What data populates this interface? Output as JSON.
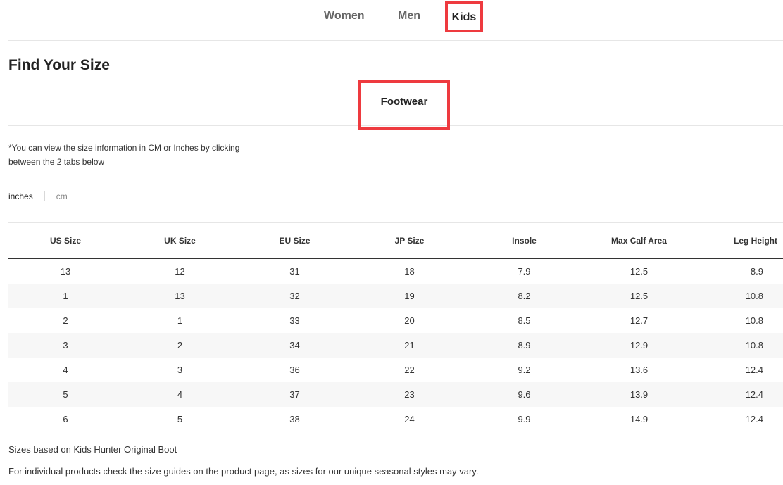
{
  "gender_tabs": [
    {
      "label": "Women"
    },
    {
      "label": "Men"
    },
    {
      "label": "Kids"
    }
  ],
  "page_title": "Find Your Size",
  "category_tab": "Footwear",
  "note": "*You can view the size information in CM or Inches by clicking between the 2 tabs below",
  "units": {
    "inches": "inches",
    "cm": "cm"
  },
  "table": {
    "headers": [
      "US Size",
      "UK Size",
      "EU Size",
      "JP Size",
      "Insole",
      "Max Calf Area",
      "Leg Height"
    ],
    "rows": [
      [
        "13",
        "12",
        "31",
        "18",
        "7.9",
        "12.5",
        "8.9"
      ],
      [
        "1",
        "13",
        "32",
        "19",
        "8.2",
        "12.5",
        "10.8"
      ],
      [
        "2",
        "1",
        "33",
        "20",
        "8.5",
        "12.7",
        "10.8"
      ],
      [
        "3",
        "2",
        "34",
        "21",
        "8.9",
        "12.9",
        "10.8"
      ],
      [
        "4",
        "3",
        "36",
        "22",
        "9.2",
        "13.6",
        "12.4"
      ],
      [
        "5",
        "4",
        "37",
        "23",
        "9.6",
        "13.9",
        "12.4"
      ],
      [
        "6",
        "5",
        "38",
        "24",
        "9.9",
        "14.9",
        "12.4"
      ]
    ]
  },
  "footnotes": [
    "Sizes based on Kids Hunter Original Boot",
    "For individual products check the size guides on the product page, as sizes for our unique seasonal styles may vary."
  ],
  "colors": {
    "highlight": "#ee3a3f",
    "zebra": "#f7f7f7"
  }
}
